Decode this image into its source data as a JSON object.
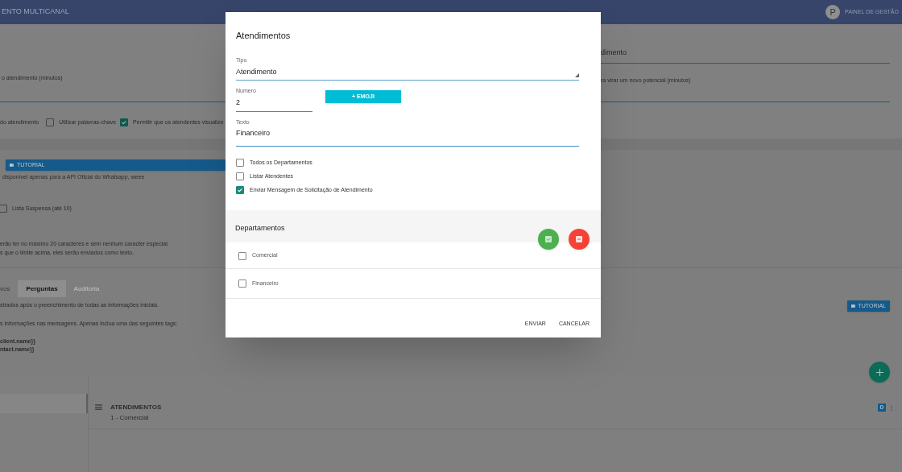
{
  "app_bar": {
    "title": "ENTO MULTICANAL",
    "avatar": "P",
    "panel_link": "PAINEL DE GESTÃO"
  },
  "settings": {
    "field_value": "dimento",
    "left_field_label": "o atendimento (minutos)",
    "right_field_label": "ra virar um novo potencial (minutos)",
    "options": [
      {
        "kind": "text",
        "label": "do atendimento"
      },
      {
        "kind": "checkbox",
        "label": "Utilizar palavras-chave",
        "checked": false
      },
      {
        "kind": "checkbox",
        "label": "Permitir que os atendentes visualize",
        "checked": true
      }
    ]
  },
  "buttons_section": {
    "tutorial_button": "TUTORIAL",
    "note": "disponível apenas para a API Oficial do Whatsapp, weee",
    "list_option": {
      "label": "Lista Suspensa (até 10)",
      "checked": false
    },
    "rules": [
      "erão ter no máximo 20 caracteres e sem nenhum caracter especial.",
      "s que o limite acima, eles serão enviados como texto."
    ]
  },
  "tabs": [
    {
      "label": "vos",
      "selected": false,
      "disabled": false
    },
    {
      "label": "Perguntas",
      "selected": true,
      "disabled": false
    },
    {
      "label": "Auditoria",
      "selected": false,
      "disabled": true
    }
  ],
  "questions": {
    "help": [
      "strados após o preenchimento de todas as informações iniciais.",
      "s informações nas mensagens. Apenas inclua uma das seguintes tags:"
    ],
    "tags": [
      "client.name}}",
      "ntact.name}}"
    ],
    "tutorial_button": "TUTORIAL"
  },
  "menu_item": {
    "title": "ATENDIMENTOS",
    "subtitle": "1 - Comercial",
    "badge": "0"
  },
  "dialog": {
    "title": "Atendimentos",
    "type_field": {
      "label": "Tipo",
      "value": "Atendimento"
    },
    "number_field": {
      "label": "Numero",
      "value": "2"
    },
    "emoji_button": "+ EMOJI",
    "text_field": {
      "label": "Texto",
      "value": "Financeiro"
    },
    "options": [
      {
        "label": "Todos os Departamentos",
        "checked": false
      },
      {
        "label": "Listar Atendentes",
        "checked": false
      },
      {
        "label": "Enviar Mensagem de Solicitação de Atendimento",
        "checked": true
      }
    ],
    "departments_title": "Departamentos",
    "departments": [
      {
        "label": "Comercial",
        "checked": false
      },
      {
        "label": "Financeiro",
        "checked": false
      }
    ],
    "actions": [
      "ENVIAR",
      "CANCELAR"
    ]
  }
}
